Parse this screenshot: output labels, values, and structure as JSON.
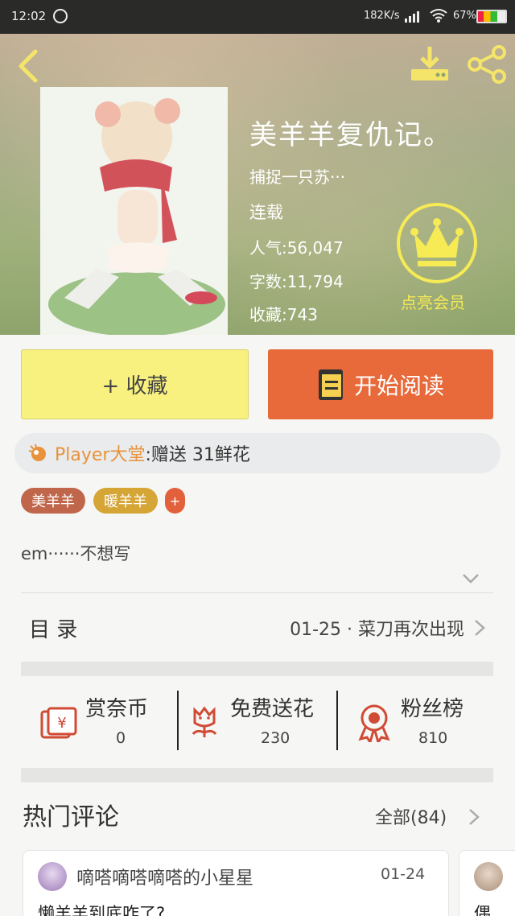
{
  "status_bar": {
    "time": "12:02",
    "net_speed": "182K/s",
    "battery": "67%"
  },
  "book": {
    "title": "美羊羊复仇记。",
    "intro": "捕捉一只苏···",
    "status": "连载",
    "popularity": "人气:56,047",
    "word_count": "字数:11,794",
    "favorites": "收藏:743"
  },
  "member": {
    "label": "点亮会员",
    "icon": "crown-icon",
    "color": "#f6ea55"
  },
  "actions": {
    "collect_label": "+ 收藏",
    "read_label": "开始阅读"
  },
  "ticker": {
    "user": "Player大堂",
    "message": ":赠送 31鲜花"
  },
  "tags": [
    "美羊羊",
    "暖羊羊",
    "+"
  ],
  "description": "em······不想写",
  "catalog": {
    "label": "目 录",
    "latest": "01-25 · 菜刀再次出现"
  },
  "stats": [
    {
      "icon": "red-envelope-icon",
      "label": "赏奈币",
      "value": "0"
    },
    {
      "icon": "flower-icon",
      "label": "免费送花",
      "value": "230"
    },
    {
      "icon": "medal-icon",
      "label": "粉丝榜",
      "value": "810"
    }
  ],
  "comments": {
    "title": "热门评论",
    "all_label": "全部(84)",
    "items": [
      {
        "user": "嘀嗒嘀嗒嘀嗒的小星星",
        "date": "01-24",
        "text": "懒羊羊到底咋了?"
      },
      {
        "user": "",
        "date": "",
        "text": "偶"
      }
    ]
  },
  "colors": {
    "accent_orange": "#e8693a",
    "collect_yellow": "#f8f180",
    "tag_red": "#c0674b",
    "tag_gold": "#d5a535"
  }
}
